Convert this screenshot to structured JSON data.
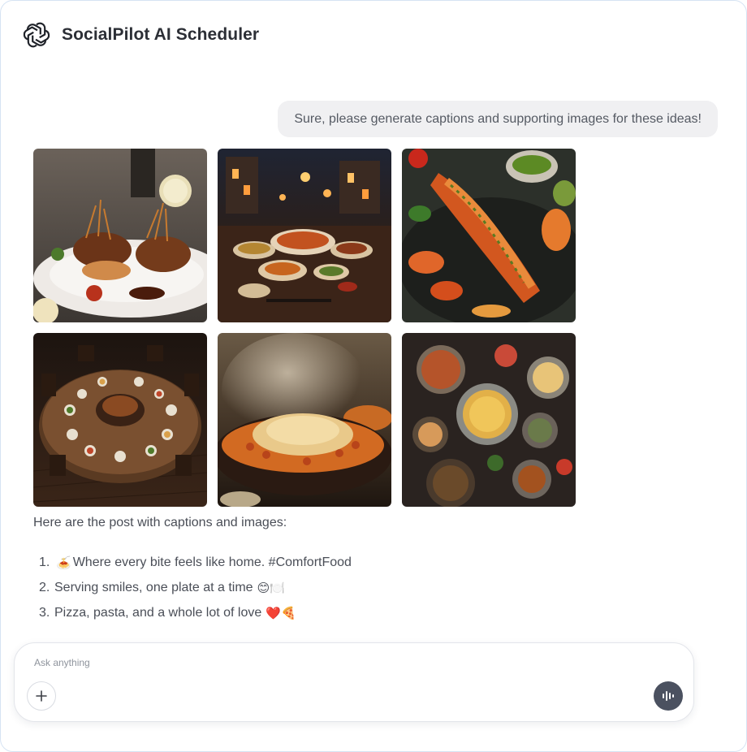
{
  "app": {
    "title": "SocialPilot AI Scheduler",
    "logo_icon": "openai-knot-icon"
  },
  "conversation": {
    "user_message": "Sure, please generate captions and supporting images for these ideas!",
    "images": [
      {
        "subject": "steak-with-crispy-onions"
      },
      {
        "subject": "night-market-feast"
      },
      {
        "subject": "grilled-lobster"
      },
      {
        "subject": "round-table-banquet"
      },
      {
        "subject": "steaming-rice-bowl"
      },
      {
        "subject": "overhead-spread"
      }
    ],
    "intro": "Here are the post with captions and images:",
    "captions": [
      {
        "number": "1.",
        "emoji_before": "🍝",
        "text": "Where every bite feels like home. #ComfortFood",
        "emoji_after": ""
      },
      {
        "number": "2.",
        "emoji_before": "",
        "text": "Serving smiles, one plate at a time",
        "emoji_after": "😊🍽️"
      },
      {
        "number": "3.",
        "emoji_before": "",
        "text": "Pizza, pasta, and a whole lot of love",
        "emoji_after": "❤️🍕"
      }
    ]
  },
  "composer": {
    "placeholder": "Ask anything",
    "value": "",
    "add_icon": "plus-icon",
    "voice_icon": "voice-waveform-icon"
  },
  "colors": {
    "voice_button": "#4b5160",
    "bubble": "#f0f0f2",
    "border": "#d6e3f3"
  }
}
